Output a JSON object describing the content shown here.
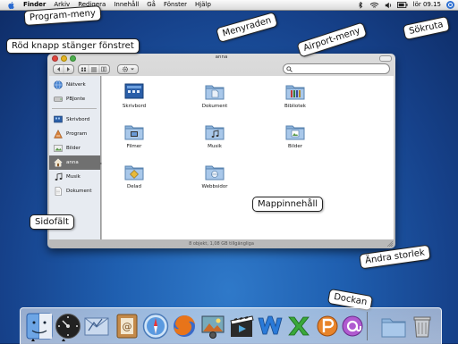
{
  "menubar": {
    "items": [
      "Finder",
      "Arkiv",
      "Redigera",
      "Innehåll",
      "Gå",
      "Fönster",
      "Hjälp"
    ],
    "clock": "lör 09.15"
  },
  "window": {
    "title": "anna",
    "status": "8 objekt, 1,08 GB tillgängliga"
  },
  "sidebar": {
    "items": [
      {
        "label": "Nätverk",
        "icon": "globe-icon"
      },
      {
        "label": "PBJonte",
        "icon": "harddisk-icon"
      },
      {
        "label": "Skrivbord",
        "icon": "desktop-icon"
      },
      {
        "label": "Program",
        "icon": "applications-icon"
      },
      {
        "label": "Bilder",
        "icon": "pictures-icon"
      },
      {
        "label": "anna",
        "icon": "home-icon",
        "selected": true
      },
      {
        "label": "Musik",
        "icon": "music-icon"
      },
      {
        "label": "Dokument",
        "icon": "documents-icon"
      }
    ]
  },
  "content": {
    "folders": [
      {
        "label": "Skrivbord",
        "icon": "desktop-folder-icon"
      },
      {
        "label": "Dokument",
        "icon": "documents-folder-icon"
      },
      {
        "label": "Bibliotek",
        "icon": "library-folder-icon"
      },
      {
        "label": "Filmer",
        "icon": "movies-folder-icon"
      },
      {
        "label": "Musik",
        "icon": "music-folder-icon"
      },
      {
        "label": "Bilder",
        "icon": "pictures-folder-icon"
      },
      {
        "label": "Delad",
        "icon": "shared-folder-icon"
      },
      {
        "label": "Webbsidor",
        "icon": "sites-folder-icon"
      }
    ]
  },
  "callouts": {
    "program_meny": "Program-meny",
    "menyraden": "Menyraden",
    "airport_meny": "Airport-meny",
    "sokruta": "Sökruta",
    "rod_knapp": "Röd knapp stänger fönstret",
    "sidofalt": "Sidofält",
    "mappinnehall": "Mappinnehåll",
    "andra_storlek": "Ändra storlek",
    "dockan": "Dockan"
  },
  "dock": {
    "items": [
      "finder-icon",
      "dashboard-icon",
      "mail-icon",
      "address-book-icon",
      "safari-icon",
      "firefox-icon",
      "iphoto-icon",
      "imovie-icon",
      "word-icon",
      "excel-icon",
      "powerpoint-icon",
      "entourage-icon",
      "applications-stack-icon",
      "trash-icon"
    ]
  },
  "colors": {
    "close": "#e0443a",
    "minimize": "#e6b325",
    "zoom": "#4cae4c",
    "selection": "#707070"
  }
}
